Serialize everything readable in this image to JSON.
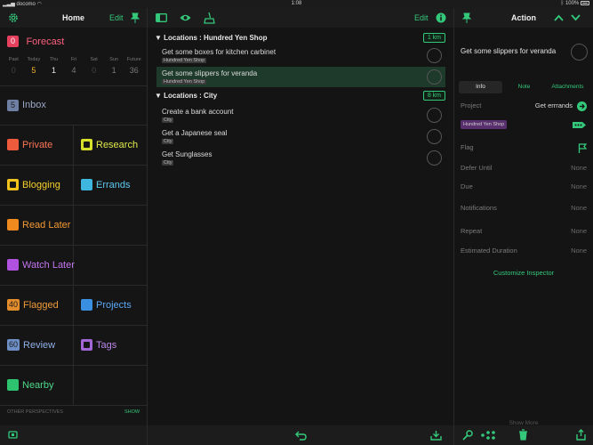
{
  "status_bar": {
    "carrier": "docomo",
    "time": "1:08",
    "battery": "100%"
  },
  "left": {
    "title": "Home",
    "edit_label": "Edit",
    "forecast": {
      "label": "Forecast",
      "count": "0",
      "days": [
        {
          "name": "Past",
          "count": "0"
        },
        {
          "name": "Today",
          "count": "5"
        },
        {
          "name": "Thu",
          "count": "1"
        },
        {
          "name": "Fri",
          "count": "4"
        },
        {
          "name": "Sat",
          "count": "0"
        },
        {
          "name": "Sun",
          "count": "1"
        },
        {
          "name": "Future",
          "count": "36"
        }
      ]
    },
    "inbox": {
      "label": "Inbox",
      "count": "5"
    },
    "private": "Private",
    "research": "Research",
    "blogging": "Blogging",
    "errands": "Errands",
    "read_later": "Read Later",
    "watch_later": "Watch Later",
    "flagged": {
      "label": "Flagged",
      "count": "40"
    },
    "projects": "Projects",
    "review": {
      "label": "Review",
      "count": "60"
    },
    "tags": "Tags",
    "nearby": "Nearby",
    "other_perspectives": "OTHER PERSPECTIVES",
    "show_label": "SHOW"
  },
  "mid": {
    "edit_label": "Edit",
    "groups": [
      {
        "title": "Locations : Hundred Yen Shop",
        "distance": "1 km",
        "tasks": [
          {
            "title": "Get some boxes for kitchen carbinet",
            "tag": "Hundred Yen Shop"
          },
          {
            "title": "Get some slippers for veranda",
            "tag": "Hundred Yen Shop"
          }
        ]
      },
      {
        "title": "Locations : City",
        "distance": "8 km",
        "tasks": [
          {
            "title": "Create a bank account",
            "tag": "City"
          },
          {
            "title": "Get a Japanese seal",
            "tag": "City"
          },
          {
            "title": "Get Sunglasses",
            "tag": "City"
          }
        ]
      }
    ]
  },
  "right": {
    "title": "Action",
    "task_title": "Get some slippers for veranda",
    "tabs": [
      "Info",
      "Note",
      "Attachments"
    ],
    "project_label": "Project",
    "project_value": "Get errrands",
    "tag_value": "Hundred Yen Shop",
    "flag_label": "Flag",
    "defer_label": "Defer Until",
    "due_label": "Due",
    "notifications_label": "Notifications",
    "repeat_label": "Repeat",
    "duration_label": "Estimated Duration",
    "none": "None",
    "customize_label": "Customize Inspector",
    "show_more_label": "Show More"
  },
  "colors": {
    "accent": "#34c97a",
    "selected_row": "#1e3a2b"
  }
}
